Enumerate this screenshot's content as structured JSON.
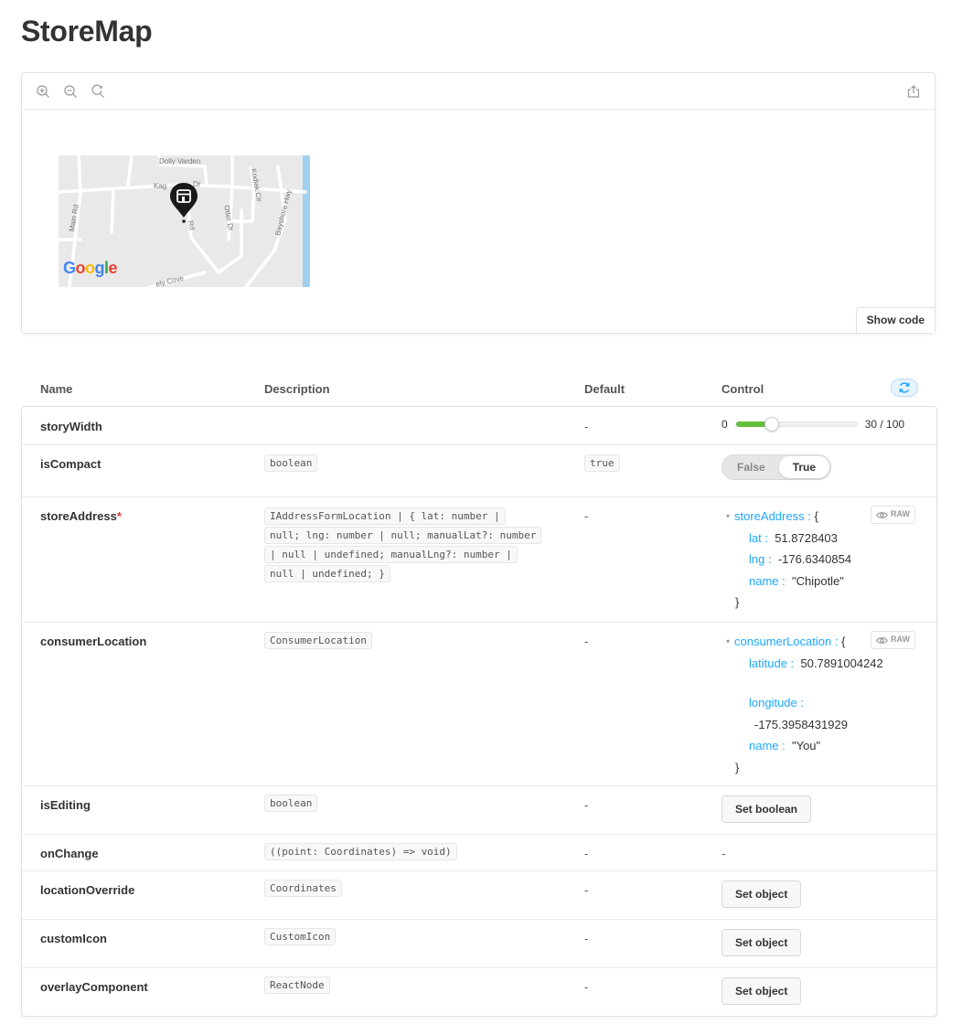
{
  "page": {
    "title": "StoreMap"
  },
  "preview": {
    "toolbar": {
      "zoom_in": "zoom-in-icon",
      "zoom_out": "zoom-out-icon",
      "reset": "reset-zoom-icon",
      "share": "share-icon"
    },
    "map": {
      "streets": [
        "Dolly Varden",
        "Kag",
        "Dr",
        "Main Rd",
        "Kodiak Cir",
        "Otter Dr",
        "Bayshore Hwy",
        "Rd",
        "ely Cove"
      ],
      "logo": "Google",
      "logo_colors": [
        "#4285F4",
        "#EA4335",
        "#FBBC05",
        "#4285F4",
        "#34A853",
        "#EA4335"
      ]
    },
    "show_code_label": "Show code"
  },
  "args_table": {
    "headers": {
      "name": "Name",
      "description": "Description",
      "default": "Default",
      "control": "Control"
    },
    "reset_icon": "refresh-icon",
    "rows": {
      "story_width": {
        "name": "storyWidth",
        "default": "-",
        "control": {
          "min": "0",
          "max_label": "30 / 100",
          "value": 30,
          "max": 100
        }
      },
      "is_compact": {
        "name": "isCompact",
        "type": "boolean",
        "default": "true",
        "control": {
          "false_label": "False",
          "true_label": "True",
          "selected": "True"
        }
      },
      "store_address": {
        "name": "storeAddress",
        "required_mark": "*",
        "type_lines": [
          "IAddressFormLocation | { lat: number |",
          "null; lng: number | null; manualLat?: number",
          "| null | undefined; manualLng?: number |",
          "null | undefined; }"
        ],
        "default": "-",
        "control": {
          "caret": "▾",
          "root_key": "storeAddress :",
          "open_brace": "{",
          "close_brace": "}",
          "raw_label": "RAW",
          "entries": [
            {
              "key": "lat :",
              "value": "51.8728403"
            },
            {
              "key": "lng :",
              "value": "-176.6340854"
            },
            {
              "key": "name :",
              "value": "\"Chipotle\""
            }
          ]
        }
      },
      "consumer_location": {
        "name": "consumerLocation",
        "type": "ConsumerLocation",
        "default": "-",
        "control": {
          "caret": "▾",
          "root_key": "consumerLocation :",
          "open_brace": "{",
          "close_brace": "}",
          "raw_label": "RAW",
          "entries": [
            {
              "key": "latitude :",
              "value": "50.7891004242"
            },
            {
              "key": "longitude :",
              "value": "-175.3958431929"
            },
            {
              "key": "name :",
              "value": "\"You\""
            }
          ]
        }
      },
      "is_editing": {
        "name": "isEditing",
        "type": "boolean",
        "default": "-",
        "control": {
          "button_label": "Set boolean"
        }
      },
      "on_change": {
        "name": "onChange",
        "type": "((point: Coordinates) => void)",
        "default": "-",
        "control": {
          "text": "-"
        }
      },
      "location_override": {
        "name": "locationOverride",
        "type": "Coordinates",
        "default": "-",
        "control": {
          "button_label": "Set object"
        }
      },
      "custom_icon": {
        "name": "customIcon",
        "type": "CustomIcon",
        "default": "-",
        "control": {
          "button_label": "Set object"
        }
      },
      "overlay_component": {
        "name": "overlayComponent",
        "type": "ReactNode",
        "default": "-",
        "control": {
          "button_label": "Set object"
        }
      }
    }
  },
  "colors": {
    "accent": "#1ea7fd",
    "slider_fill": "#66bf3c",
    "required": "#e0393e",
    "water": "#9fd0f0"
  }
}
